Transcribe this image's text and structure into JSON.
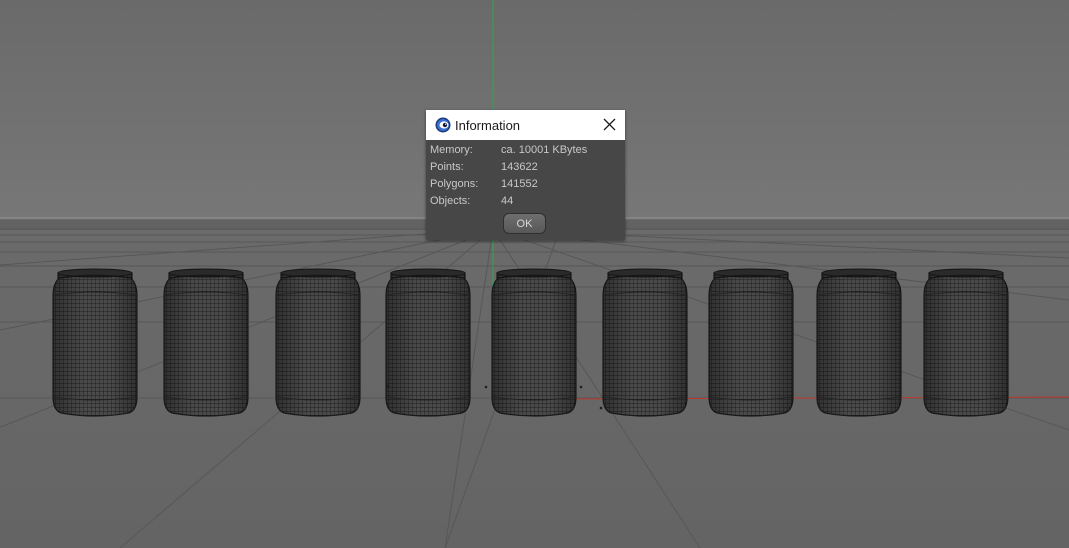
{
  "dialog": {
    "title": "Information",
    "rows": [
      {
        "label": "Memory:",
        "value": "ca. 10001 KBytes"
      },
      {
        "label": "Points:",
        "value": "143622"
      },
      {
        "label": "Polygons:",
        "value": "141552"
      },
      {
        "label": "Objects:",
        "value": "44"
      }
    ],
    "ok_label": "OK"
  },
  "scene": {
    "object_name": "can",
    "object_count_visible": 9
  },
  "colors": {
    "viewport_bg": "#6e6e6e",
    "dialog_bg": "#474747",
    "titlebar_bg": "#ffffff",
    "y_axis": "#2ea84a",
    "x_axis": "#c0392b",
    "can_body": "#4b4b4b",
    "can_wire": "#1c1c1c"
  },
  "icons": {
    "app": "cinema4d-icon",
    "close": "close-icon"
  }
}
